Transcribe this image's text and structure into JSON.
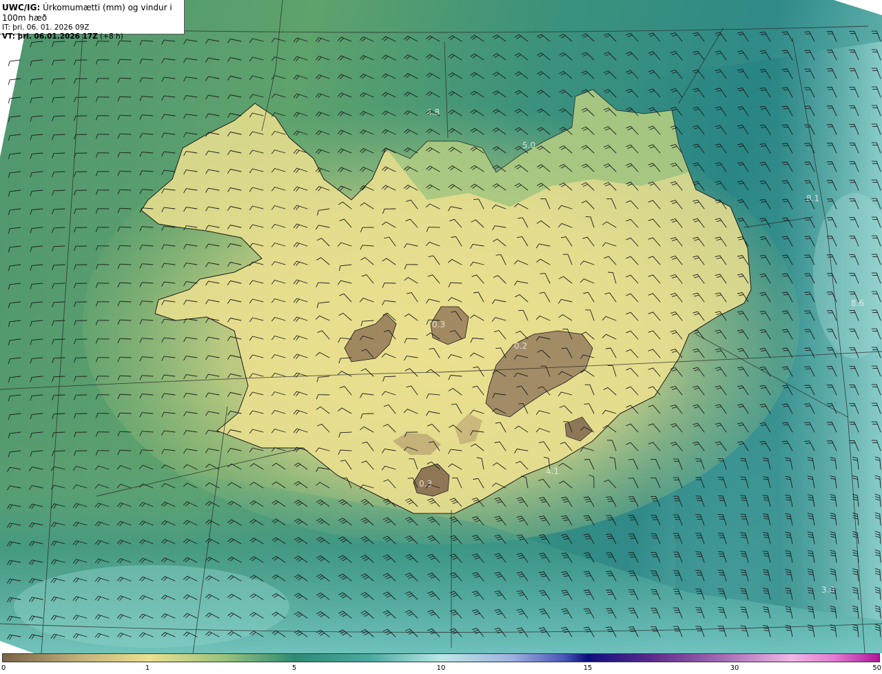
{
  "header": {
    "model": "UWC/IG:",
    "title": "Úrkomumætti (mm) og vindur i 100m hæð",
    "init_time": "IT: þri. 06. 01. 2026 09Z",
    "valid_prefix": "VT: þri. 06.01.2026 17Z",
    "valid_suffix": "(+8 h)"
  },
  "colorbar": {
    "ticks": [
      "0",
      "1",
      "5",
      "10",
      "15",
      "30",
      "50"
    ]
  },
  "value_labels": [
    "4.8",
    "5.0",
    "8.1",
    "8.6",
    "0.3",
    "0.2",
    "4.1",
    "0.3",
    "3.0"
  ],
  "colors": {
    "sea_deep": "#1f7a75",
    "land_low": "#ecdf8a",
    "land_high": "#8e7455"
  }
}
